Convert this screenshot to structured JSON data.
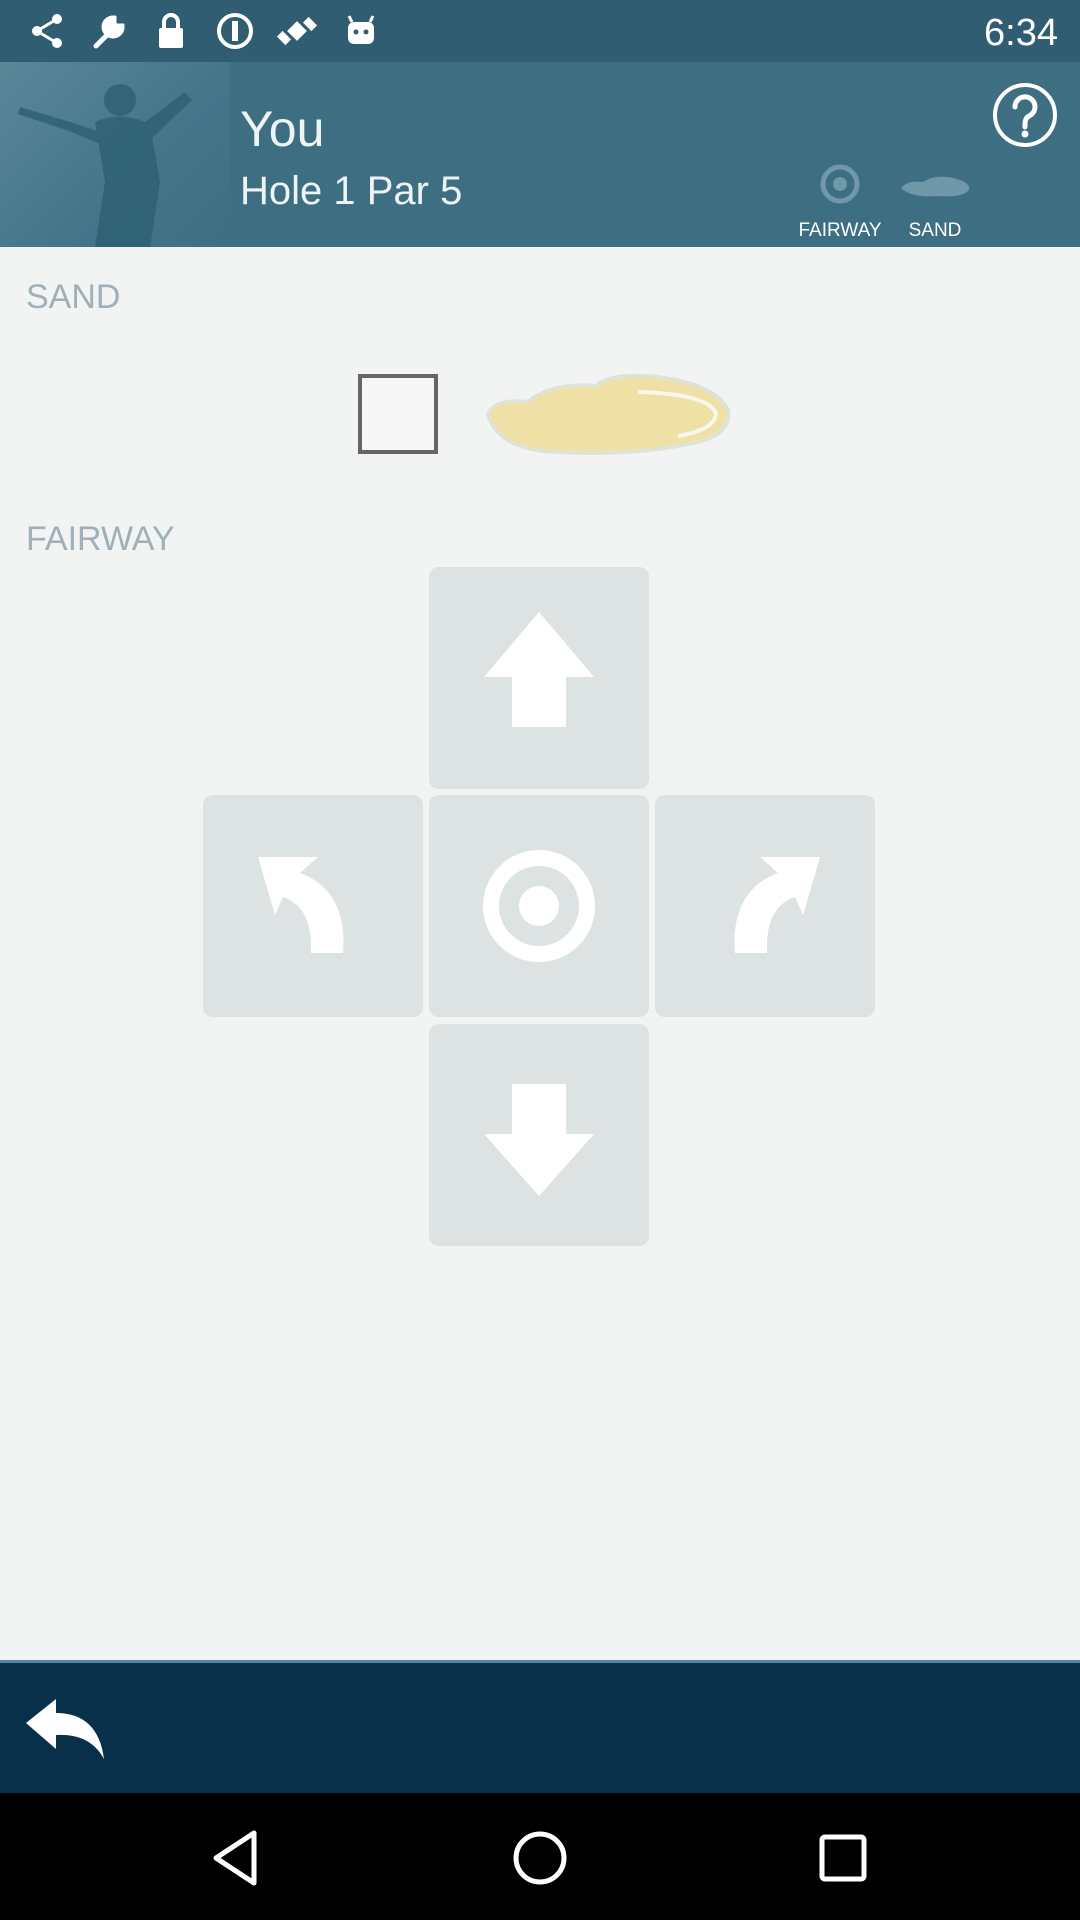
{
  "status_bar": {
    "time": "6:34",
    "icons": [
      "share-icon",
      "wrench-icon",
      "lock-icon",
      "info-icon",
      "satellite-icon",
      "android-icon"
    ]
  },
  "header": {
    "player_name": "You",
    "hole_info": "Hole 1 Par 5",
    "legend": [
      {
        "label": "FAIRWAY",
        "icon": "target-icon"
      },
      {
        "label": "SAND",
        "icon": "sand-icon"
      }
    ],
    "help_icon": "help-icon"
  },
  "sand_section": {
    "label": "SAND",
    "checked": false
  },
  "fairway_section": {
    "label": "FAIRWAY",
    "buttons": [
      "arrow-up-icon",
      "curve-left-icon",
      "target-icon",
      "curve-right-icon",
      "arrow-down-icon"
    ]
  },
  "bottom_bar": {
    "back_icon": "reply-icon"
  },
  "nav_bar": {
    "buttons": [
      "back-triangle-icon",
      "home-circle-icon",
      "recents-square-icon"
    ]
  },
  "colors": {
    "header_bg": "#3d6e82",
    "status_bg": "#305d72",
    "page_bg": "#f2f3f3",
    "tile_bg": "#dde2e3",
    "bottom_bar_bg": "#08304a",
    "section_label": "#9fb0b8",
    "sand": "#efe1a6"
  }
}
